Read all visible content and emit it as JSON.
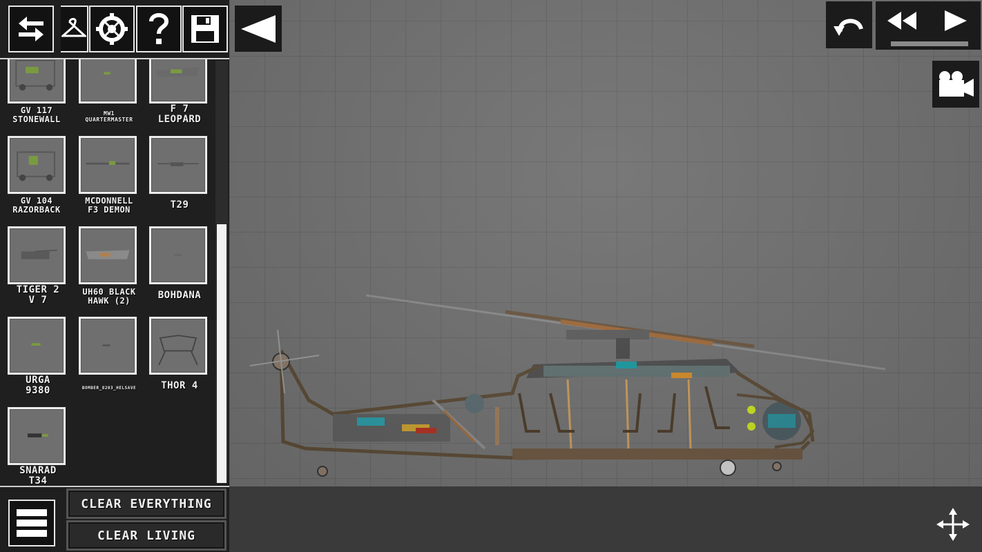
{
  "toolbar": {
    "buttons": [
      {
        "name": "swap-icon"
      },
      {
        "name": "hanger-icon"
      },
      {
        "name": "gear-icon"
      },
      {
        "name": "help-icon"
      },
      {
        "name": "save-icon"
      }
    ],
    "collapse_icon": "triangle-left-icon"
  },
  "items": [
    {
      "label_line1": "GV 117",
      "label_line2": "STONEWALL"
    },
    {
      "label_line1": "MW1",
      "label_line2": "QUARTERMASTER"
    },
    {
      "label_line1": "F 7",
      "label_line2": "LEOPARD"
    },
    {
      "label_line1": "GV 104",
      "label_line2": "RAZORBACK"
    },
    {
      "label_line1": "MCDONNELL",
      "label_line2": "F3 DEMON"
    },
    {
      "label_line1": "T29",
      "label_line2": ""
    },
    {
      "label_line1": "TIGER 2",
      "label_line2": "V 7"
    },
    {
      "label_line1": "UH60 BLACK",
      "label_line2": "HAWK (2)"
    },
    {
      "label_line1": "BOHDANA",
      "label_line2": ""
    },
    {
      "label_line1": "URGA",
      "label_line2": "9380"
    },
    {
      "label_line1": "BOMBER_8203_HELSAVE",
      "label_line2": ""
    },
    {
      "label_line1": "THOR 4",
      "label_line2": ""
    },
    {
      "label_line1": "SNARAD",
      "label_line2": "T34"
    }
  ],
  "bottom": {
    "clear_everything": "CLEAR EVERYTHING",
    "clear_living": "CLEAR LIVING"
  },
  "controls": {
    "undo_icon": "undo-icon",
    "rewind_icon": "rewind-icon",
    "play_icon": "play-icon",
    "camera_icon": "camera-icon",
    "move_icon": "move-icon"
  },
  "colors": {
    "sidebar_bg": "#1f1f1f",
    "canvas_bg": "#707070",
    "floor_bg": "#3a3a3a",
    "button_border": "#e8e8e8"
  }
}
